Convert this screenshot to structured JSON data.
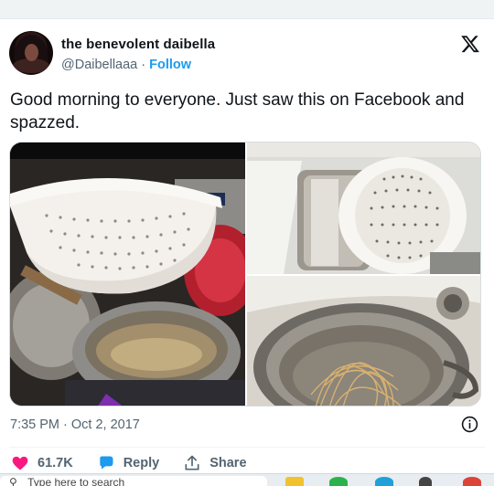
{
  "tweet": {
    "author_name": "the benevolent daibella",
    "handle": "@Daibellaaa",
    "separator": "·",
    "follow_label": "Follow",
    "text": "Good morning to everyone. Just saw this on Facebook and spazzed.",
    "timestamp": "7:35 PM · Oct 2, 2017",
    "like_count": "61.7K",
    "reply_label": "Reply",
    "share_label": "Share"
  },
  "colors": {
    "link": "#1d9bf0",
    "like_heart": "#f91880",
    "muted_text": "#536471",
    "primary_text": "#0f1419"
  },
  "icons": {
    "logo": "x-logo-icon",
    "info": "info-icon",
    "like": "heart-icon",
    "reply": "reply-bubble-icon",
    "share": "share-icon",
    "taskbar_search": "search-icon"
  },
  "taskbar": {
    "search_placeholder": "Type here to search"
  }
}
